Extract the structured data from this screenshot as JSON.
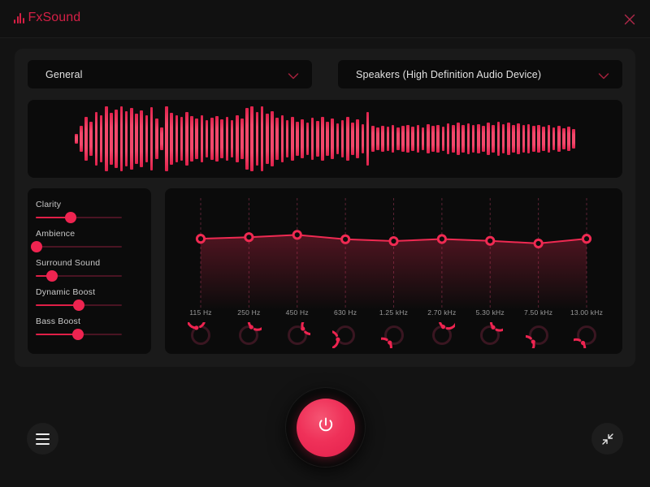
{
  "app": {
    "name": "FxSound",
    "logo_icon": "equalizer-bars-icon",
    "accent_color": "#e01f47",
    "background_color": "#131313",
    "panel_color": "#1a1a1a",
    "card_color": "#0b0b0b"
  },
  "titlebar": {
    "close_label": "close-icon"
  },
  "preset_select": {
    "value": "General",
    "chevron": "chevron-down-icon"
  },
  "device_select": {
    "value": "Speakers (High Definition Audio Device)",
    "chevron": "chevron-down-icon"
  },
  "visualizer": {
    "bar_levels": [
      12,
      34,
      58,
      46,
      72,
      64,
      86,
      70,
      78,
      88,
      74,
      82,
      68,
      76,
      62,
      84,
      54,
      30,
      88,
      70,
      64,
      58,
      72,
      60,
      54,
      62,
      50,
      56,
      60,
      52,
      58,
      50,
      62,
      54,
      82,
      86,
      72,
      88,
      68,
      74,
      56,
      62,
      50,
      58,
      46,
      52,
      44,
      56,
      48,
      58,
      46,
      54,
      42,
      50,
      58,
      44,
      52,
      40,
      72,
      34,
      30,
      34,
      32,
      36,
      30,
      34,
      38,
      32,
      36,
      30,
      40,
      34,
      38,
      32,
      42,
      36,
      44,
      38,
      42,
      36,
      40,
      34,
      44,
      38,
      46,
      40,
      44,
      38,
      42,
      36,
      40,
      34,
      38,
      32,
      36,
      30,
      34,
      28,
      32,
      26
    ]
  },
  "sliders": [
    {
      "name": "Clarity",
      "value": 41
    },
    {
      "name": "Ambience",
      "value": 1
    },
    {
      "name": "Surround Sound",
      "value": 19
    },
    {
      "name": "Dynamic Boost",
      "value": 50
    },
    {
      "name": "Bass Boost",
      "value": 49
    }
  ],
  "chart_data": {
    "type": "line",
    "title": "",
    "xlabel": "",
    "ylabel": "",
    "grid": true,
    "legend": false,
    "categories": [
      "115 Hz",
      "250 Hz",
      "450 Hz",
      "630 Hz",
      "1.25 kHz",
      "2.70 kHz",
      "5.30 kHz",
      "7.50 kHz",
      "13.00 kHz"
    ],
    "values": [
      1.2,
      1.8,
      2.7,
      1.0,
      0.3,
      1.1,
      0.4,
      -0.6,
      1.2
    ],
    "ylim": [
      -12,
      12
    ],
    "point_color": "#ef2a52",
    "line_color": "#ef2a52",
    "fill": "gradient"
  },
  "eq_bands": [
    {
      "label": "115 Hz",
      "gain": 1.2,
      "knob_angle": -30
    },
    {
      "label": "250 Hz",
      "gain": 1.8,
      "knob_angle": 18
    },
    {
      "label": "450 Hz",
      "gain": 2.7,
      "knob_angle": 40
    },
    {
      "label": "630 Hz",
      "gain": 1.0,
      "knob_angle": -120
    },
    {
      "label": "1.25 kHz",
      "gain": 0.3,
      "knob_angle": -150
    },
    {
      "label": "2.70 kHz",
      "gain": 1.1,
      "knob_angle": 8
    },
    {
      "label": "5.30 kHz",
      "gain": 0.4,
      "knob_angle": 22
    },
    {
      "label": "7.50 kHz",
      "gain": -0.6,
      "knob_angle": -140
    },
    {
      "label": "13.00 kHz",
      "gain": 1.2,
      "knob_angle": -155
    }
  ],
  "bottom": {
    "power_icon": "power-icon",
    "menu_icon": "hamburger-menu-icon",
    "resize_icon": "collapse-arrows-icon"
  }
}
